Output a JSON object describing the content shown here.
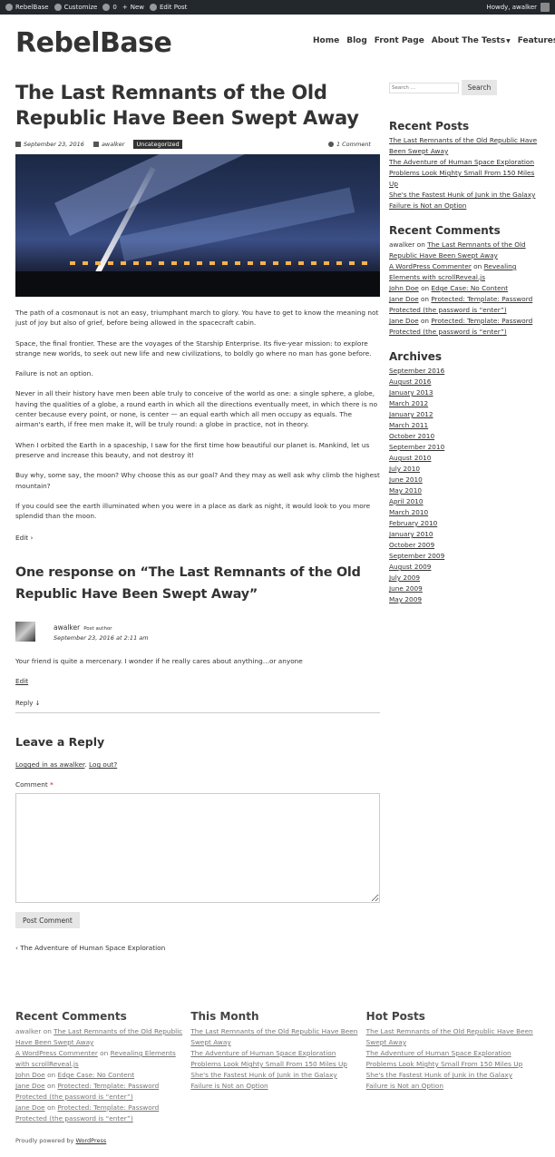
{
  "admin_bar": {
    "items": [
      "RebelBase",
      "Customize",
      "0",
      "New",
      "Edit Post"
    ],
    "greeting": "Howdy, awalker"
  },
  "site": {
    "title": "RebelBase",
    "nav": [
      "Home",
      "Blog",
      "Front Page",
      "About The Tests",
      "Features"
    ]
  },
  "post": {
    "title": "The Last Remnants of the Old Republic Have Been Swept Away",
    "date": "September 23, 2016",
    "author": "awalker",
    "category": "Uncategorized",
    "comments_count": "1 Comment",
    "paragraphs": [
      "The path of a cosmonaut is not an easy, triumphant march to glory. You have to get to know the meaning not just of joy but also of grief, before being allowed in the spacecraft cabin.",
      "Space, the final frontier. These are the voyages of the Starship Enterprise. Its five-year mission: to explore strange new worlds, to seek out new life and new civilizations, to boldly go where no man has gone before.",
      "Failure is not an option.",
      "Never in all their history have men been able truly to conceive of the world as one: a single sphere, a globe, having the qualities of a globe, a round earth in which all the directions eventually meet, in which there is no center because every point, or none, is center — an equal earth which all men occupy as equals. The airman's earth, if free men make it, will be truly round: a globe in practice, not in theory.",
      "When I orbited the Earth in a spaceship, I saw for the first time how beautiful our planet is. Mankind, let us preserve and increase this beauty, and not destroy it!",
      "Buy why, some say, the moon? Why choose this as our goal? And they may as well ask why climb the highest mountain?",
      "If you could see the earth illuminated when you were in a place as dark as night, it would look to you more splendid than the moon."
    ],
    "edit_label": "Edit"
  },
  "comments": {
    "title": "One response on “The Last Remnants of the Old Republic Have Been Swept Away”",
    "items": [
      {
        "author": "awalker",
        "badge": "Post author",
        "date": "September 23, 2016 at 2:11 am",
        "text": "Your friend is quite a mercenary. I wonder if he really cares about anything…or anyone",
        "edit": "Edit",
        "reply": "Reply ↓"
      }
    ]
  },
  "reply_form": {
    "title": "Leave a Reply",
    "logged_in": "Logged in as awalker",
    "logout": "Log out?",
    "comment_label": "Comment",
    "required_mark": "*",
    "submit": "Post Comment"
  },
  "prev_post": "‹ The Adventure of Human Space Exploration",
  "sidebar": {
    "search_placeholder": "Search …",
    "search_button": "Search",
    "recent_posts_title": "Recent Posts",
    "recent_posts": [
      "The Last Remnants of the Old Republic Have Been Swept Away",
      "The Adventure of Human Space Exploration",
      "Problems Look Mighty Small From 150 Miles Up",
      "She's the Fastest Hunk of Junk in the Galaxy",
      "Failure is Not an Option"
    ],
    "recent_comments_title": "Recent Comments",
    "recent_comments": [
      {
        "who": "awalker",
        "on": "on",
        "post": "The Last Remnants of the Old Republic Have Been Swept Away"
      },
      {
        "who": "A WordPress Commenter",
        "on": "on",
        "post": "Revealing Elements with scrollReveal.js"
      },
      {
        "who": "John Doe",
        "on": "on",
        "post": "Edge Case: No Content"
      },
      {
        "who": "Jane Doe",
        "on": "on",
        "post": "Protected: Template: Password Protected (the password is “enter”)"
      },
      {
        "who": "Jane Doe",
        "on": "on",
        "post": "Protected: Template: Password Protected (the password is “enter”)"
      }
    ],
    "archives_title": "Archives",
    "archives": [
      "September 2016",
      "August 2016",
      "January 2013",
      "March 2012",
      "January 2012",
      "March 2011",
      "October 2010",
      "September 2010",
      "August 2010",
      "July 2010",
      "June 2010",
      "May 2010",
      "April 2010",
      "March 2010",
      "February 2010",
      "January 2010",
      "October 2009",
      "September 2009",
      "August 2009",
      "July 2009",
      "June 2009",
      "May 2009"
    ]
  },
  "footer": {
    "recent_comments_title": "Recent Comments",
    "recent_comments": [
      {
        "who": "awalker",
        "on": "on",
        "post": "The Last Remnants of the Old Republic Have Been Swept Away"
      },
      {
        "who": "A WordPress Commenter",
        "on": "on",
        "post": "Revealing Elements with scrollReveal.js"
      },
      {
        "who": "John Doe",
        "on": "on",
        "post": "Edge Case: No Content"
      },
      {
        "who": "Jane Doe",
        "on": "on",
        "post": "Protected: Template: Password Protected (the password is “enter”)"
      },
      {
        "who": "Jane Doe",
        "on": "on",
        "post": "Protected: Template: Password Protected (the password is “enter”)"
      }
    ],
    "this_month_title": "This Month",
    "this_month": [
      "The Last Remnants of the Old Republic Have Been Swept Away",
      "The Adventure of Human Space Exploration",
      "Problems Look Mighty Small From 150 Miles Up",
      "She's the Fastest Hunk of Junk in the Galaxy",
      "Failure is Not an Option"
    ],
    "hot_posts_title": "Hot Posts",
    "hot_posts": [
      "The Last Remnants of the Old Republic Have Been Swept Away",
      "The Adventure of Human Space Exploration",
      "Problems Look Mighty Small From 150 Miles Up",
      "She's the Fastest Hunk of Junk in the Galaxy",
      "Failure is Not an Option"
    ],
    "powered_prefix": "Proudly powered by",
    "powered_link": "WordPress"
  }
}
